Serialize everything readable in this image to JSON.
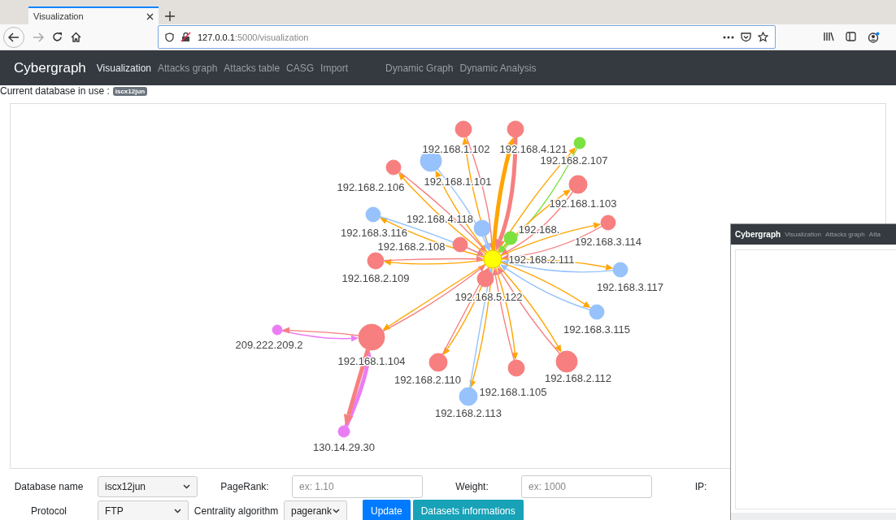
{
  "browser": {
    "tabs": [
      {
        "title": "Visualization",
        "selected": true
      }
    ],
    "url_host": "127.0.0.1",
    "url_path": ":5000/visualization"
  },
  "navbar": {
    "brand": "Cybergraph",
    "links": [
      {
        "label": "Visualization",
        "selected": true
      },
      {
        "label": "Attacks graph",
        "selected": false
      },
      {
        "label": "Attacks table",
        "selected": false
      },
      {
        "label": "CASG",
        "selected": false
      },
      {
        "label": "Import",
        "selected": false
      }
    ],
    "links_right": [
      {
        "label": "Dynamic Graph",
        "selected": false
      },
      {
        "label": "Dynamic Analysis",
        "selected": false
      }
    ]
  },
  "database_line": {
    "label": "Current database in use :",
    "badge": "iscx12jun"
  },
  "graph": {
    "nodes": [
      {
        "label": "192.168.1.102",
        "color": "#f77f7f"
      },
      {
        "label": "192.168.4.121",
        "color": "#f77f7f"
      },
      {
        "label": "192.168.2.107",
        "color": "#7be141"
      },
      {
        "label": "192.168.2.106",
        "color": "#f77f7f"
      },
      {
        "label": "192.168.1.101",
        "color": "#97c2fc"
      },
      {
        "label": "192.168.1.103",
        "color": "#f77f7f"
      },
      {
        "label": "192.168.3.116",
        "color": "#97c2fc"
      },
      {
        "label": "192.168.3.114",
        "color": "#f77f7f"
      },
      {
        "label": "192.168.4.118",
        "color": "#97c2fc"
      },
      {
        "label": "192.168.",
        "color": "#7be141"
      },
      {
        "label": "192.168.2.108",
        "color": "#f77f7f"
      },
      {
        "label": "192.168.2.111",
        "color": "#ffff00"
      },
      {
        "label": "192.168.2.109",
        "color": "#f77f7f"
      },
      {
        "label": "192.168.3.117",
        "color": "#97c2fc"
      },
      {
        "label": "192.168.5.122",
        "color": "#f77f7f"
      },
      {
        "label": "192.168.3.115",
        "color": "#97c2fc"
      },
      {
        "label": "209.222.209.2",
        "color": "#eb7df4"
      },
      {
        "label": "192.168.1.104",
        "color": "#f77f7f"
      },
      {
        "label": "192.168.2.110",
        "color": "#f77f7f"
      },
      {
        "label": "192.168.2.113",
        "color": "#97c2fc"
      },
      {
        "label": "192.168.1.105",
        "color": "#f77f7f"
      },
      {
        "label": "192.168.2.112",
        "color": "#f77f7f"
      },
      {
        "label": "130.14.29.30",
        "color": "#eb7df4"
      }
    ]
  },
  "form": {
    "database_label": "Database name",
    "database_value": "iscx12jun",
    "pagerank_label": "PageRank:",
    "pagerank_placeholder": "ex: 1.10",
    "weight_label": "Weight:",
    "weight_placeholder": "ex: 1000",
    "ip_label": "IP:",
    "protocol_label": "Protocol",
    "protocol_value": "FTP",
    "centrality_label": "Centrality algorithm",
    "centrality_value": "pagerank",
    "buttons": [
      "Update",
      "Datasets informations"
    ]
  },
  "overlay_window": {
    "brand": "Cybergraph",
    "links": [
      "Visualization",
      "Attacks graph",
      "Atta"
    ]
  }
}
